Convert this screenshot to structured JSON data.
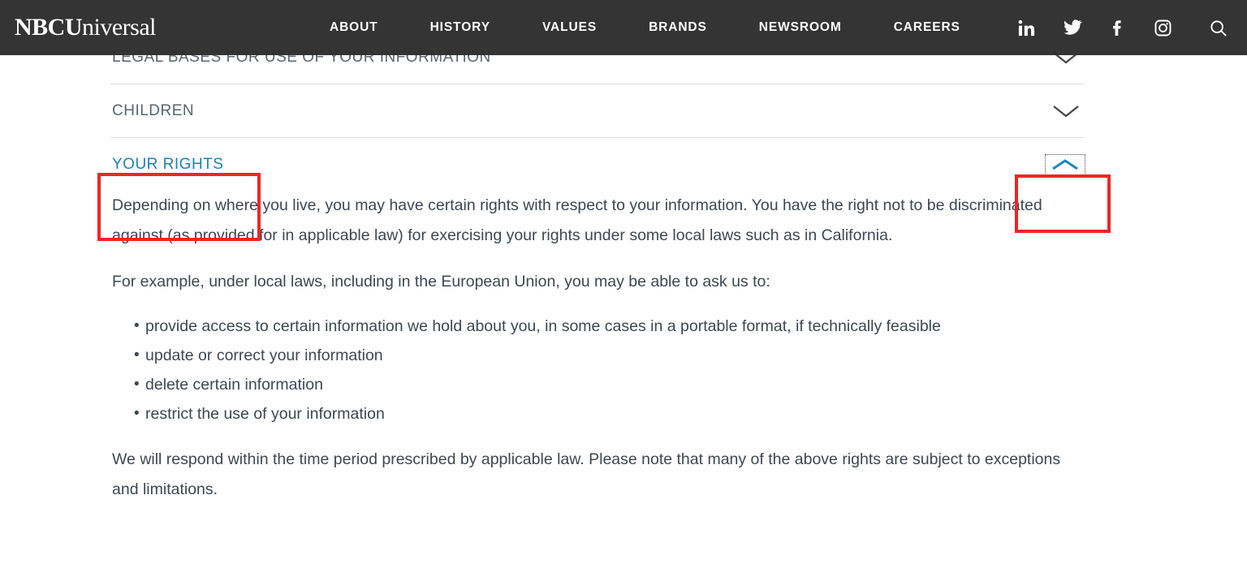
{
  "header": {
    "brand": {
      "bold": "NBCU",
      "light": "niversal"
    },
    "nav_items": [
      {
        "label": "ABOUT"
      },
      {
        "label": "HISTORY"
      },
      {
        "label": "VALUES"
      },
      {
        "label": "BRANDS"
      },
      {
        "label": "NEWSROOM"
      },
      {
        "label": "CAREERS"
      }
    ],
    "social": [
      {
        "name": "linkedin-icon"
      },
      {
        "name": "twitter-icon"
      },
      {
        "name": "facebook-icon"
      },
      {
        "name": "instagram-icon"
      }
    ],
    "search": {
      "name": "search-icon"
    },
    "background_color": "#2d2d2d",
    "text_color": "#ffffff"
  },
  "accordion": {
    "sections": [
      {
        "title": "LEGAL BASES FOR USE OF YOUR INFORMATION",
        "state": "collapsed",
        "toggle_icon": "chevron-down-icon"
      },
      {
        "title": "CHILDREN",
        "state": "collapsed",
        "toggle_icon": "chevron-down-icon"
      },
      {
        "title": "YOUR RIGHTS",
        "state": "expanded",
        "toggle_icon": "chevron-up-icon",
        "title_color": "#1f80b5",
        "toggle_color": "#1a86c8",
        "focused": true,
        "body": {
          "paragraph_1": "Depending on where you live, you may have certain rights with respect to your information. You have the right not to be discriminated against (as provided for in applicable law) for exercising your rights under some local laws such as in California.",
          "paragraph_2": "For example, under local laws, including in the European Union, you may be able to ask us to:",
          "bullets": [
            "provide access to certain information we hold about you, in some cases in a portable format, if technically feasible",
            "update or correct your information",
            "delete certain information",
            "restrict the use of your information"
          ],
          "paragraph_3": "We will respond within the time period prescribed by applicable law. Please note that many of the above rights are subject to exceptions and limitations."
        }
      }
    ]
  },
  "annotations": {
    "color": "#ef2526",
    "boxes": [
      {
        "target": "your-rights-title"
      },
      {
        "target": "your-rights-toggle"
      }
    ]
  }
}
